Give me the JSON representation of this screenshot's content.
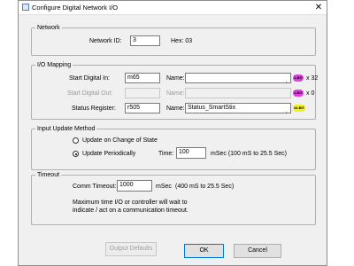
{
  "window": {
    "title": "Configure Digital Network I/O",
    "close": "✕"
  },
  "network": {
    "group_label": "Network",
    "id_label": "Network ID:",
    "id_value": "3",
    "hex_label": "Hex: 03"
  },
  "io_mapping": {
    "group_label": "I/O Mapping",
    "name_label": "Name:",
    "start_in_label": "Start Digital In:",
    "start_in_value": "m65",
    "start_in_name": "",
    "start_in_badge": "1-BIT",
    "start_in_count": "x 32",
    "start_out_label": "Start Digital Out:",
    "start_out_value": "",
    "start_out_name": "",
    "start_out_badge": "1-BIT",
    "start_out_count": "x 0",
    "status_label": "Status Register:",
    "status_value": "r505",
    "status_name": "Status_SmartStix",
    "status_badge": "16-BIT",
    "badge_colors": {
      "one_bit": "#e040e0",
      "sixteen_bit": "#f0f020"
    }
  },
  "update": {
    "group_label": "Input Update Method",
    "option_change": "Update on Change of State",
    "option_periodic": "Update Periodically",
    "selected": "periodic",
    "time_label": "Time:",
    "time_value": "100",
    "time_unit": "mSec (100 mS to 25.5 Sec)"
  },
  "timeout": {
    "group_label": "Timeout",
    "comm_label": "Comm Timeout:",
    "comm_value": "1000",
    "comm_unit": "mSec",
    "comm_range": "(400 mS to 25.5 Sec)",
    "note_line1": "Maximum time I/O or controller will wait to",
    "note_line2": "indicate / act on a communication timeout."
  },
  "buttons": {
    "output_defaults": "Output Defaults",
    "ok": "OK",
    "cancel": "Cancel"
  }
}
